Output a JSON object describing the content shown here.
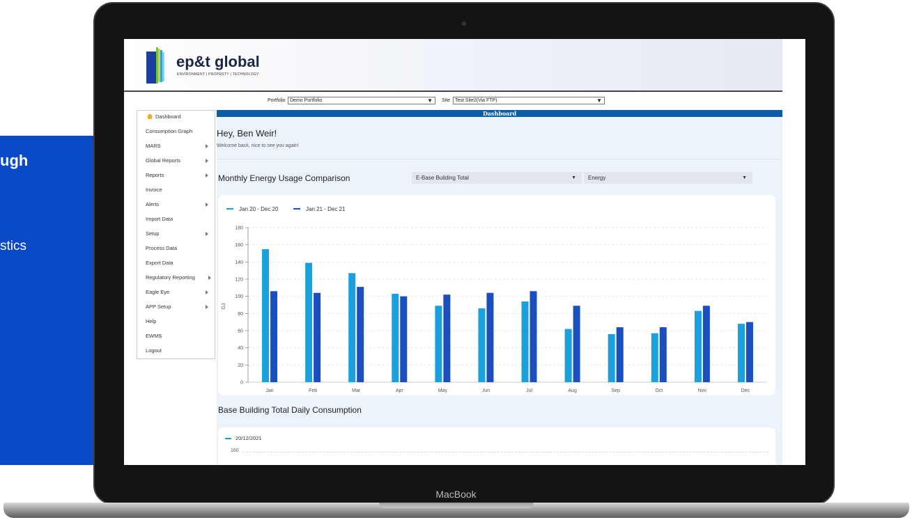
{
  "promo": {
    "heading": "ugh",
    "text": "stics"
  },
  "device": {
    "brand": "MacBook"
  },
  "app": {
    "logo_name": "ep&t global",
    "logo_tagline": "ENVIRONMENT | PROPERTY | TECHNOLOGY"
  },
  "selectors": {
    "portfolio_label": "Portfolio",
    "portfolio_value": "Demo Portfolio",
    "site_label": "Site",
    "site_value": "Test Site2(Via FTP)"
  },
  "sidebar": {
    "items": [
      {
        "label": "Dashboard",
        "has_submenu": false,
        "icon": "home-icon"
      },
      {
        "label": "Consumption Graph",
        "has_submenu": false
      },
      {
        "label": "MARS",
        "has_submenu": true
      },
      {
        "label": "Global Reports",
        "has_submenu": true
      },
      {
        "label": "Reports",
        "has_submenu": true
      },
      {
        "label": "Invoice",
        "has_submenu": false
      },
      {
        "label": "Alerts",
        "has_submenu": true
      },
      {
        "label": "Import Data",
        "has_submenu": false
      },
      {
        "label": "Setup",
        "has_submenu": true
      },
      {
        "label": "Process Data",
        "has_submenu": false
      },
      {
        "label": "Export Data",
        "has_submenu": false
      },
      {
        "label": "Regulatory Reporting",
        "has_submenu": true
      },
      {
        "label": "Eagle Eye",
        "has_submenu": true
      },
      {
        "label": "APP Setup",
        "has_submenu": true
      },
      {
        "label": "Help",
        "has_submenu": false
      },
      {
        "label": "EWMS",
        "has_submenu": false
      },
      {
        "label": "Logout",
        "has_submenu": false
      }
    ]
  },
  "dashboard": {
    "bar_title": "Dashboard",
    "greeting": "Hey, Ben Weir!",
    "welcome": "Welcome back, nice to see you again!",
    "monthly_title": "Monthly Energy Usage Comparison",
    "meter_select": "E-Base Building Total",
    "type_select": "Energy",
    "daily_title": "Base Building Total Daily Consumption",
    "daily_legend": "20/12/2021",
    "daily_first_tick": "160"
  },
  "colors": {
    "series1": "#1aa0dc",
    "series2": "#1b4fc0",
    "brand": "#0a5ea8",
    "promo": "#0a49c5"
  },
  "chart_data": {
    "type": "bar",
    "ylabel": "GJ",
    "ylim": [
      0,
      180
    ],
    "yticks": [
      0,
      20,
      40,
      60,
      80,
      100,
      120,
      140,
      160,
      180
    ],
    "grid": true,
    "legend_position": "top-left",
    "categories": [
      "Jan",
      "Feb",
      "Mar",
      "Apr",
      "May",
      "Jun",
      "Jul",
      "Aug",
      "Sep",
      "Oct",
      "Nov",
      "Dec"
    ],
    "series": [
      {
        "name": "Jan 20 - Dec 20",
        "values": [
          155,
          139,
          127,
          103,
          89,
          86,
          94,
          62,
          56,
          57,
          83,
          68
        ]
      },
      {
        "name": "Jan 21 - Dec 21",
        "values": [
          106,
          104,
          111,
          100,
          102,
          104,
          106,
          89,
          64,
          64,
          89,
          70
        ]
      }
    ]
  }
}
